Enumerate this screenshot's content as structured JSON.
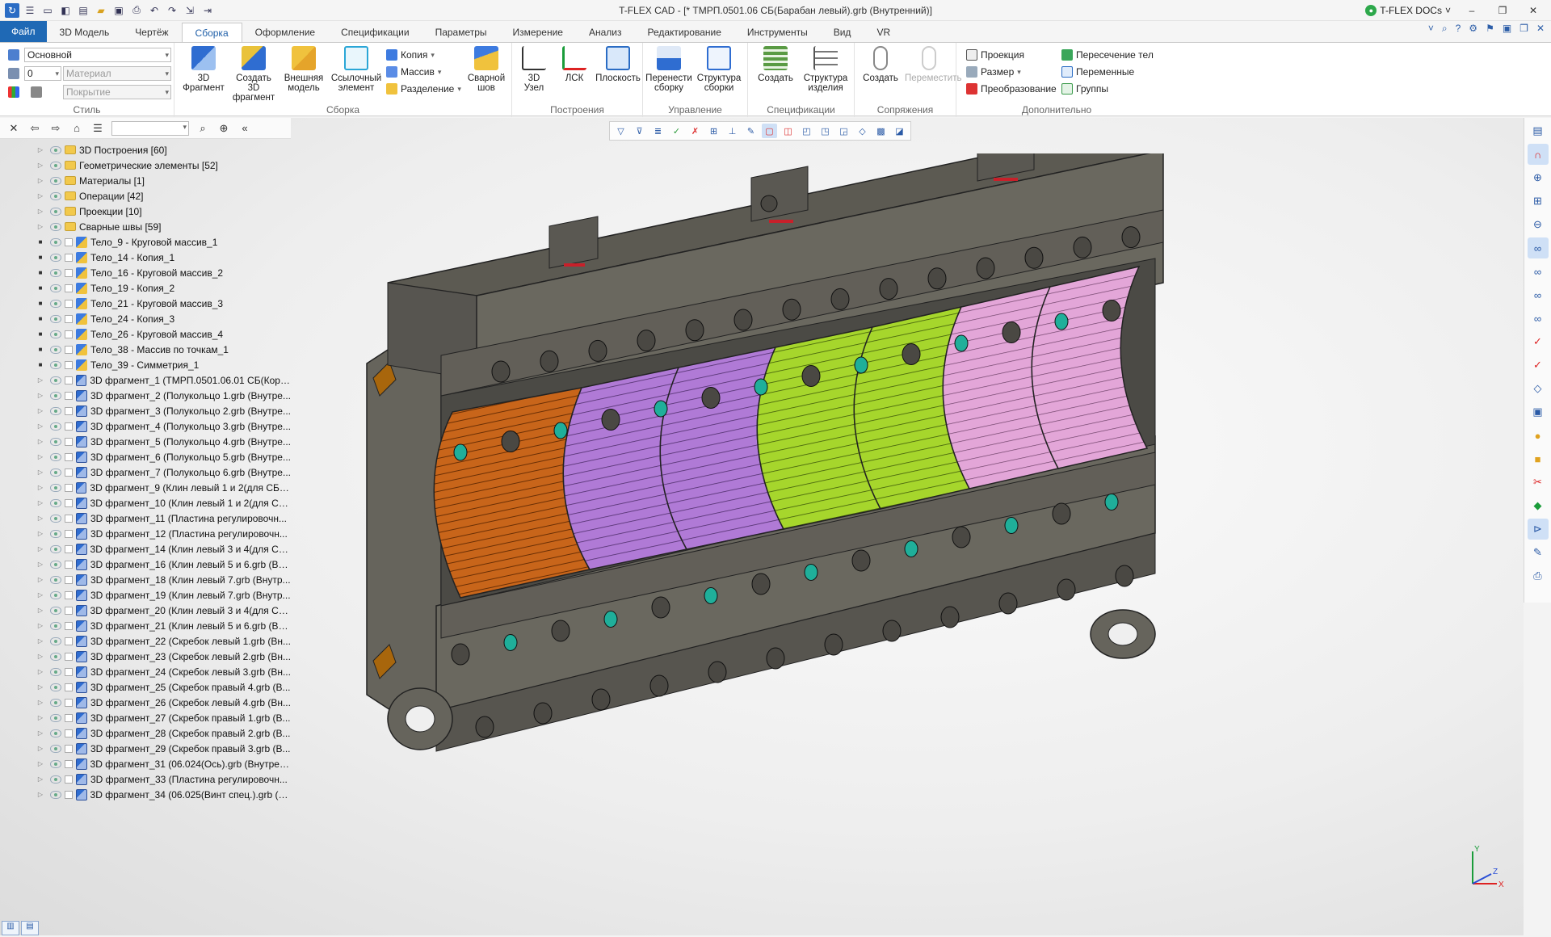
{
  "window": {
    "title": "T-FLEX CAD - [* ТМРП.0501.06 СБ(Барабан левый).grb (Внутренний)]",
    "docs_label": "T-FLEX DOCs",
    "docs_caret": "˅",
    "min": "–",
    "restore": "❐",
    "close": "✕"
  },
  "tabs": [
    "Файл",
    "3D Модель",
    "Чертёж",
    "Сборка",
    "Оформление",
    "Спецификации",
    "Параметры",
    "Измерение",
    "Анализ",
    "Редактирование",
    "Инструменты",
    "Вид",
    "VR"
  ],
  "active_tab": "Сборка",
  "ribbon": {
    "style": {
      "label": "Стиль",
      "layer": "Основной",
      "level": "0",
      "material_placeholder": "Материал",
      "coating_placeholder": "Покрытие"
    },
    "assembly": {
      "label": "Сборка",
      "fragment": "3D\nФрагмент",
      "create_fragment": "Создать 3D\nфрагмент",
      "external_model": "Внешняя\nмодель",
      "ref_element": "Ссылочный\nэлемент",
      "copy": "Копия",
      "array": "Массив",
      "split": "Разделение",
      "weld": "Сварной\nшов"
    },
    "build": {
      "label": "Построения",
      "node": "3D\nУзел",
      "lcs": "ЛСК",
      "plane": "Плоскость"
    },
    "manage": {
      "label": "Управление",
      "move_assembly": "Перенести\nсборку",
      "assembly_structure": "Структура\nсборки"
    },
    "spec": {
      "label": "Спецификации",
      "create": "Создать",
      "product_structure": "Структура\nизделия"
    },
    "mates": {
      "label": "Сопряжения",
      "create": "Создать",
      "move": "Переместить"
    },
    "extra": {
      "label": "Дополнительно",
      "projection": "Проекция",
      "size": "Размер",
      "transform": "Преобразование",
      "intersection": "Пересечение тел",
      "variables": "Переменные",
      "groups": "Группы"
    }
  },
  "tree": [
    {
      "kind": "folder",
      "label": "3D Построения [60]"
    },
    {
      "kind": "folder",
      "label": "Геометрические элементы [52]"
    },
    {
      "kind": "folder",
      "label": "Материалы [1]"
    },
    {
      "kind": "folder",
      "label": "Операции [42]"
    },
    {
      "kind": "folder",
      "label": "Проекции [10]"
    },
    {
      "kind": "folder",
      "label": "Сварные швы [59]"
    },
    {
      "kind": "body",
      "label": "Тело_9 - Круговой массив_1"
    },
    {
      "kind": "body",
      "label": "Тело_14 - Копия_1"
    },
    {
      "kind": "body",
      "label": "Тело_16 - Круговой массив_2"
    },
    {
      "kind": "body",
      "label": "Тело_19 - Копия_2"
    },
    {
      "kind": "body",
      "label": "Тело_21 - Круговой массив_3"
    },
    {
      "kind": "body",
      "label": "Тело_24 - Копия_3"
    },
    {
      "kind": "body",
      "label": "Тело_26 - Круговой массив_4"
    },
    {
      "kind": "body",
      "label": "Тело_38 - Массив по точкам_1"
    },
    {
      "kind": "body",
      "label": "Тело_39 - Симметрия_1"
    },
    {
      "kind": "frag",
      "label": "3D фрагмент_1 (ТМРП.0501.06.01 СБ(Корп..."
    },
    {
      "kind": "frag",
      "label": "3D фрагмент_2 (Полукольцо 1.grb (Внутре..."
    },
    {
      "kind": "frag",
      "label": "3D фрагмент_3 (Полукольцо 2.grb (Внутре..."
    },
    {
      "kind": "frag",
      "label": "3D фрагмент_4 (Полукольцо 3.grb (Внутре..."
    },
    {
      "kind": "frag",
      "label": "3D фрагмент_5 (Полукольцо 4.grb (Внутре..."
    },
    {
      "kind": "frag",
      "label": "3D фрагмент_6 (Полукольцо 5.grb (Внутре..."
    },
    {
      "kind": "frag",
      "label": "3D фрагмент_7 (Полукольцо 6.grb (Внутре..."
    },
    {
      "kind": "frag",
      "label": "3D фрагмент_9 (Клин левый 1 и 2(для СБ)...."
    },
    {
      "kind": "frag",
      "label": "3D фрагмент_10 (Клин левый 1 и 2(для СБ..."
    },
    {
      "kind": "frag",
      "label": "3D фрагмент_11 (Пластина регулировочн..."
    },
    {
      "kind": "frag",
      "label": "3D фрагмент_12 (Пластина регулировочн..."
    },
    {
      "kind": "frag",
      "label": "3D фрагмент_14 (Клин левый 3 и 4(для СБ..."
    },
    {
      "kind": "frag",
      "label": "3D фрагмент_16 (Клин левый 5 и 6.grb (Вн..."
    },
    {
      "kind": "frag",
      "label": "3D фрагмент_18 (Клин левый 7.grb (Внутр..."
    },
    {
      "kind": "frag",
      "label": "3D фрагмент_19 (Клин левый 7.grb (Внутр..."
    },
    {
      "kind": "frag",
      "label": "3D фрагмент_20 (Клин левый 3 и 4(для СБ..."
    },
    {
      "kind": "frag",
      "label": "3D фрагмент_21 (Клин левый 5 и 6.grb (Вн..."
    },
    {
      "kind": "frag",
      "label": "3D фрагмент_22 (Скребок левый 1.grb (Вн..."
    },
    {
      "kind": "frag",
      "label": "3D фрагмент_23 (Скребок левый 2.grb (Вн..."
    },
    {
      "kind": "frag",
      "label": "3D фрагмент_24 (Скребок левый 3.grb (Вн..."
    },
    {
      "kind": "frag",
      "label": "3D фрагмент_25 (Скребок правый 4.grb (В..."
    },
    {
      "kind": "frag",
      "label": "3D фрагмент_26 (Скребок левый 4.grb (Вн..."
    },
    {
      "kind": "frag",
      "label": "3D фрагмент_27 (Скребок правый 1.grb (В..."
    },
    {
      "kind": "frag",
      "label": "3D фрагмент_28 (Скребок правый 2.grb (В..."
    },
    {
      "kind": "frag",
      "label": "3D фрагмент_29 (Скребок правый 3.grb (В..."
    },
    {
      "kind": "frag",
      "label": "3D фрагмент_31 (06.024(Ось).grb (Внутрен..."
    },
    {
      "kind": "frag",
      "label": "3D фрагмент_33 (Пластина регулировочн..."
    },
    {
      "kind": "frag",
      "label": "3D фрагмент_34 (06.025(Винт спец.).grb (В..."
    }
  ],
  "axes": {
    "x": "X",
    "y": "Y",
    "z": "Z"
  },
  "colors": {
    "accent": "#1f69b5",
    "housing": "#64625a",
    "orange_segment": "#c25e12",
    "purple_segment": "#b27fd6",
    "green_segment": "#a8d530",
    "pink_segment": "#e6a8da",
    "bolt_teal": "#1faf9a"
  }
}
